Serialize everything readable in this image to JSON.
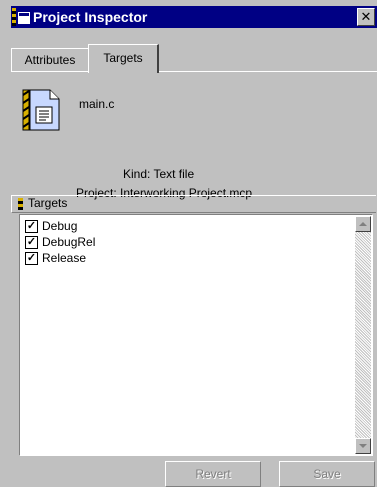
{
  "window": {
    "title": "Project Inspector",
    "close_glyph": "✕"
  },
  "tabs": [
    {
      "label": "Attributes",
      "selected": false
    },
    {
      "label": "Targets",
      "selected": true
    }
  ],
  "file": {
    "icon": "text-file-icon",
    "name": "main.c",
    "kind": "Kind: Text file",
    "project": "Project: Interworking Project.mcp"
  },
  "targets": {
    "header": "Targets",
    "items": [
      {
        "label": "Debug",
        "checked": true
      },
      {
        "label": "DebugRel",
        "checked": true
      },
      {
        "label": "Release",
        "checked": true
      }
    ],
    "check_glyph": "✓"
  },
  "buttons": {
    "revert": "Revert",
    "save": "Save"
  },
  "colors": {
    "title_bar": "#000084",
    "face": "#c0c0c0",
    "disabled_text": "#808080"
  }
}
